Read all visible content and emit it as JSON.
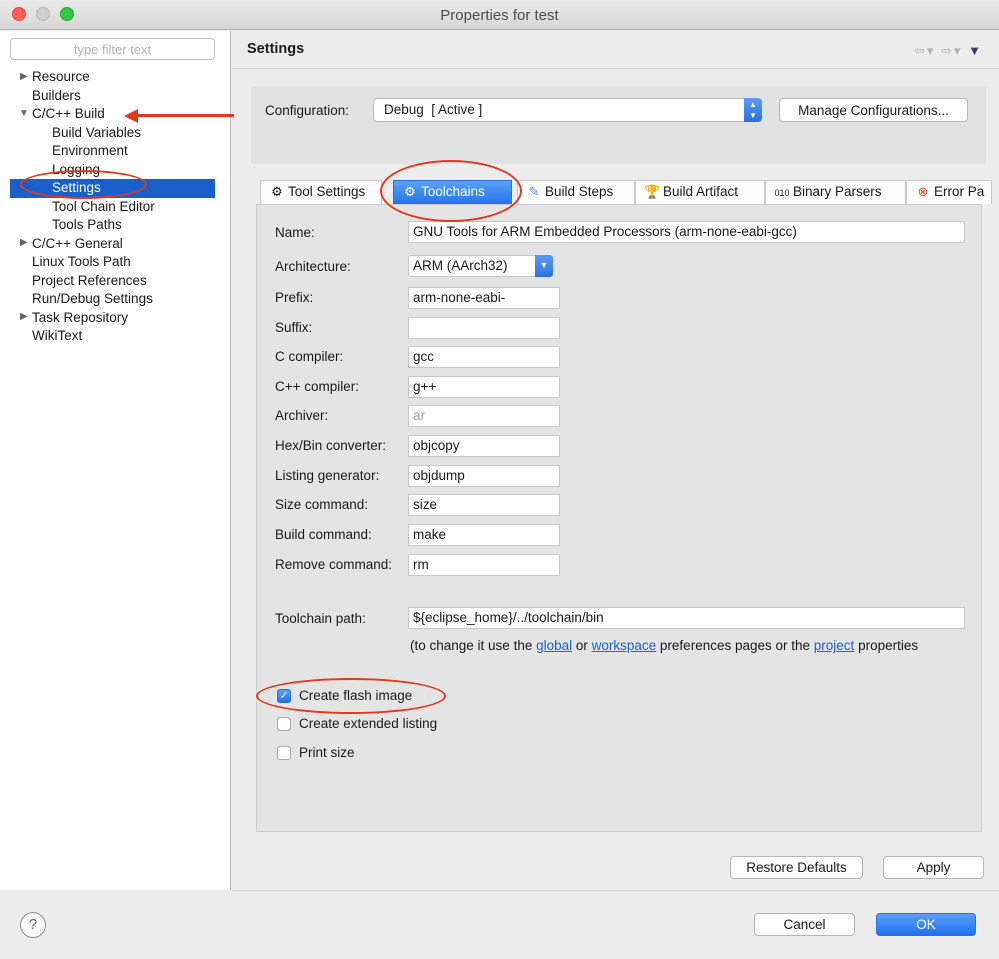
{
  "window": {
    "title": "Properties for test"
  },
  "filter": {
    "placeholder": "type filter text"
  },
  "tree": {
    "items": [
      {
        "label": "Resource",
        "expandable": true,
        "expanded": false
      },
      {
        "label": "Builders"
      },
      {
        "label": "C/C++ Build",
        "expandable": true,
        "expanded": true
      },
      {
        "label": "Build Variables"
      },
      {
        "label": "Environment"
      },
      {
        "label": "Logging"
      },
      {
        "label": "Settings",
        "selected": true
      },
      {
        "label": "Tool Chain Editor"
      },
      {
        "label": "Tools Paths"
      },
      {
        "label": "C/C++ General",
        "expandable": true,
        "expanded": false
      },
      {
        "label": "Linux Tools Path"
      },
      {
        "label": "Project References"
      },
      {
        "label": "Run/Debug Settings"
      },
      {
        "label": "Task Repository",
        "expandable": true,
        "expanded": false
      },
      {
        "label": "WikiText"
      }
    ]
  },
  "header": {
    "title": "Settings",
    "back_icon": "back-arrow-icon",
    "forward_icon": "forward-arrow-icon",
    "menu_icon": "view-menu-icon"
  },
  "configuration": {
    "label": "Configuration:",
    "value": "Debug  [ Active ]",
    "manage_button": "Manage Configurations..."
  },
  "tabs": [
    {
      "label": "Tool Settings",
      "icon": "tool-settings-icon"
    },
    {
      "label": "Toolchains",
      "icon": "toolchains-icon",
      "active": true
    },
    {
      "label": "Build Steps",
      "icon": "build-steps-icon"
    },
    {
      "label": "Build Artifact",
      "icon": "build-artifact-icon"
    },
    {
      "label": "Binary Parsers",
      "icon": "binary-parsers-icon"
    },
    {
      "label": "Error Pa",
      "icon": "error-parsers-icon"
    }
  ],
  "toolchain": {
    "name_label": "Name:",
    "name_value": "GNU Tools for ARM Embedded Processors (arm-none-eabi-gcc)",
    "arch_label": "Architecture:",
    "arch_value": "ARM (AArch32)",
    "fields": [
      {
        "label": "Prefix:",
        "value": "arm-none-eabi-"
      },
      {
        "label": "Suffix:",
        "value": ""
      },
      {
        "label": "C compiler:",
        "value": "gcc"
      },
      {
        "label": "C++ compiler:",
        "value": "g++"
      },
      {
        "label": "Archiver:",
        "value": "ar",
        "disabled": true
      },
      {
        "label": "Hex/Bin converter:",
        "value": "objcopy"
      },
      {
        "label": "Listing generator:",
        "value": "objdump"
      },
      {
        "label": "Size command:",
        "value": "size"
      },
      {
        "label": "Build command:",
        "value": "make"
      },
      {
        "label": "Remove command:",
        "value": "rm"
      }
    ],
    "path_label": "Toolchain path:",
    "path_value": "${eclipse_home}/../toolchain/bin",
    "hint": {
      "pre": "(to change it use the ",
      "link1": "global",
      "mid1": " or ",
      "link2": "workspace",
      "mid2": " preferences pages or the ",
      "link3": "project",
      "post": " properties"
    },
    "checkboxes": [
      {
        "label": "Create flash image",
        "checked": true
      },
      {
        "label": "Create extended listing",
        "checked": false
      },
      {
        "label": "Print size",
        "checked": false
      }
    ]
  },
  "buttons": {
    "restore_defaults": "Restore Defaults",
    "apply": "Apply",
    "cancel": "Cancel",
    "ok": "OK"
  },
  "help": {
    "icon": "help-icon",
    "glyph": "?"
  },
  "annotation_color": "#e03a1d",
  "accent_color": "#1f73f1"
}
